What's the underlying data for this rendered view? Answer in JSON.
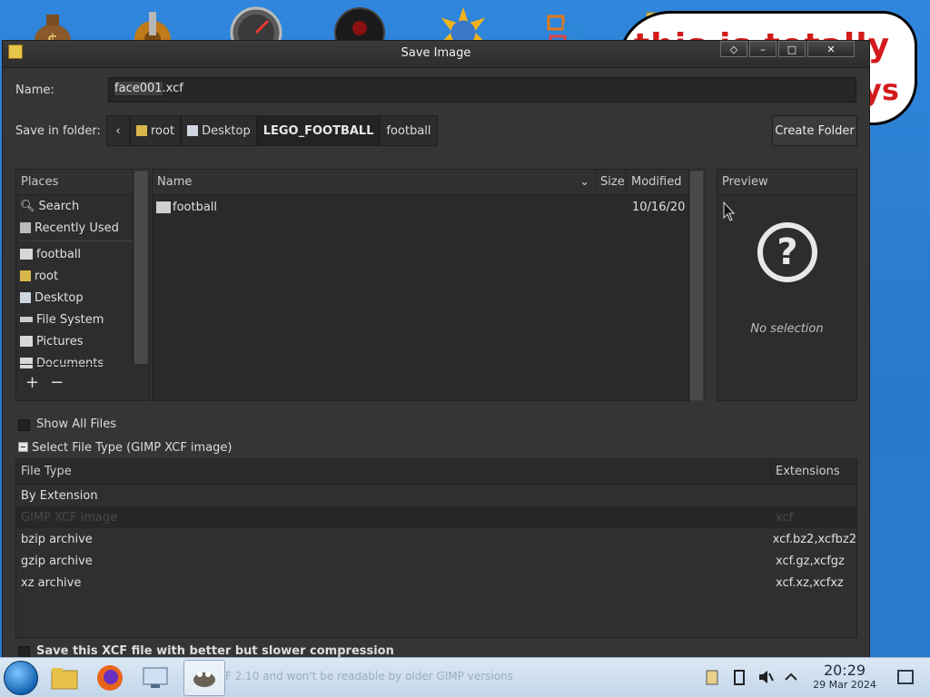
{
  "dialog": {
    "title": "Save Image",
    "name_label": "Name:",
    "name_value_selected": "face001",
    "name_value_ext": ".xcf",
    "folder_label": "Save in folder:",
    "breadcrumbs": [
      "root",
      "Desktop",
      "LEGO_FOOTBALL",
      "football"
    ],
    "create_folder": "Create Folder",
    "places_header": "Places",
    "places": [
      "Search",
      "Recently Used",
      "football",
      "root",
      "Desktop",
      "File System",
      "Pictures",
      "Documents"
    ],
    "files_header": {
      "name": "Name",
      "size": "Size",
      "modified": "Modified"
    },
    "files": [
      {
        "name": "football",
        "size": "",
        "modified": "10/16/20"
      }
    ],
    "preview_header": "Preview",
    "preview_empty": "No selection",
    "show_all_files": "Show All Files",
    "select_file_type": "Select File Type (GIMP XCF image)",
    "ftype_headers": {
      "type": "File Type",
      "ext": "Extensions"
    },
    "ftypes": [
      {
        "type": "By Extension",
        "ext": ""
      },
      {
        "type": "GIMP XCF image",
        "ext": "xcf"
      },
      {
        "type": "bzip archive",
        "ext": "xcf.bz2,xcfbz2"
      },
      {
        "type": "gzip archive",
        "ext": "xcf.gz,xcfgz"
      },
      {
        "type": "xz archive",
        "ext": "xcf.xz,xcfxz"
      }
    ],
    "compression_label": "Save this XCF file with better but slower compression"
  },
  "desktop": {
    "bubble_text": "this is totally",
    "bubble_text2": "ys"
  },
  "taskbar": {
    "ghost_text": "F 2.10 and won't be readable by older GIMP versions",
    "time": "20:29",
    "date": "29 Mar 2024"
  },
  "colors": {
    "dialog_bg": "#353535",
    "taskbar": "#c3d6ea",
    "desktop": "#2f86dc"
  }
}
